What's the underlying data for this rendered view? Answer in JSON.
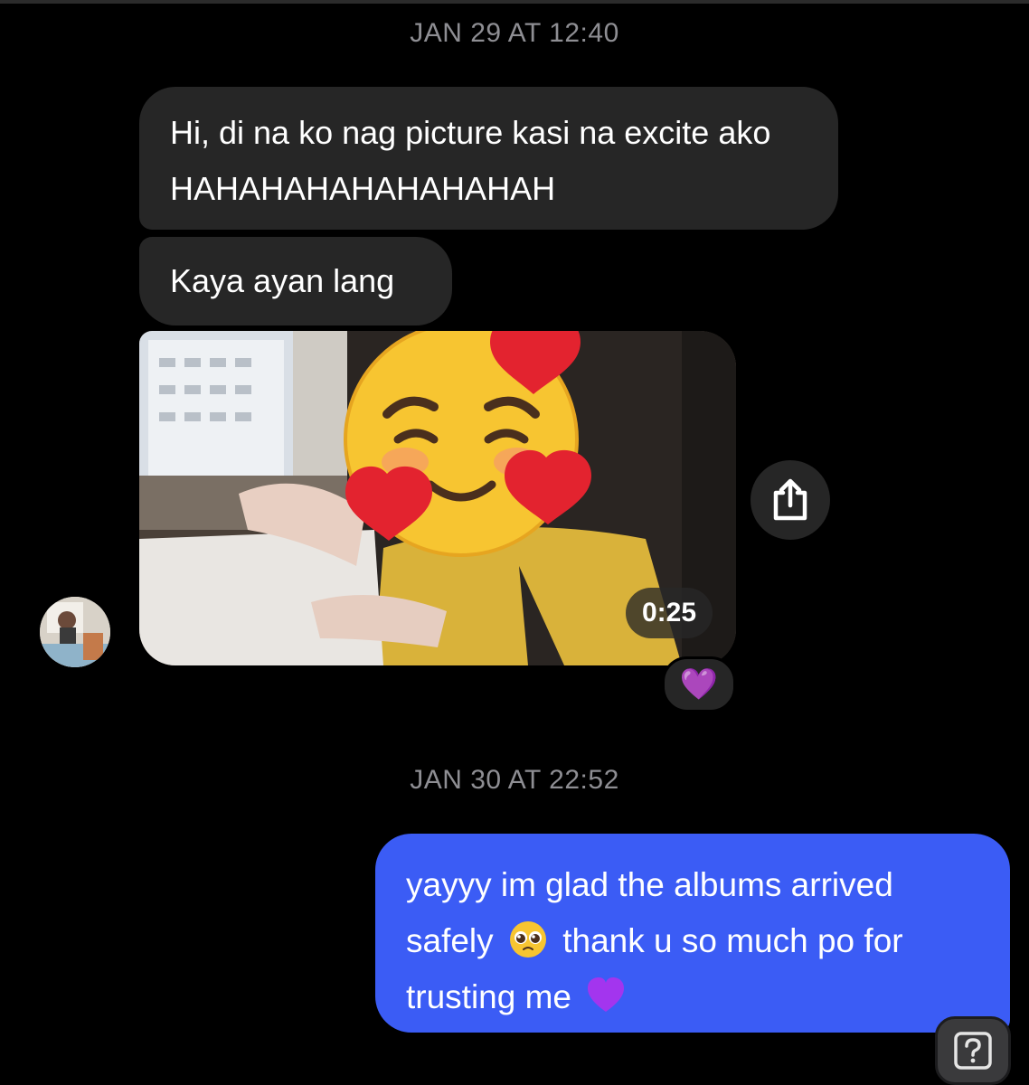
{
  "thread": {
    "timestamp_1": "JAN 29 AT 12:40",
    "timestamp_2": "JAN 30 AT 22:52",
    "messages": [
      {
        "from": "them",
        "text": "Hi, di na ko nag picture kasi na excite ako HAHAHAHAHAHAHAHAH"
      },
      {
        "from": "them",
        "text": "Kaya ayan lang"
      },
      {
        "from": "them",
        "type": "video",
        "duration": "0:25",
        "reaction": "💜"
      }
    ],
    "reply": {
      "line1": "yayyy im glad the albums arrived",
      "line2_a": "safely",
      "line2_b": "thank u so much po for",
      "line3": "trusting me",
      "emoji_pleading": "🥺",
      "emoji_heart": "💜"
    }
  },
  "icons": {
    "share": "share-icon",
    "help": "help-icon",
    "video_overlay": "smiling-face-with-hearts-icon"
  },
  "colors": {
    "background": "#000000",
    "incoming_bubble": "#262626",
    "outgoing_bubble": "#3b5cf5",
    "timestamp": "#8e8e93",
    "reaction_heart": "#a335ee"
  }
}
